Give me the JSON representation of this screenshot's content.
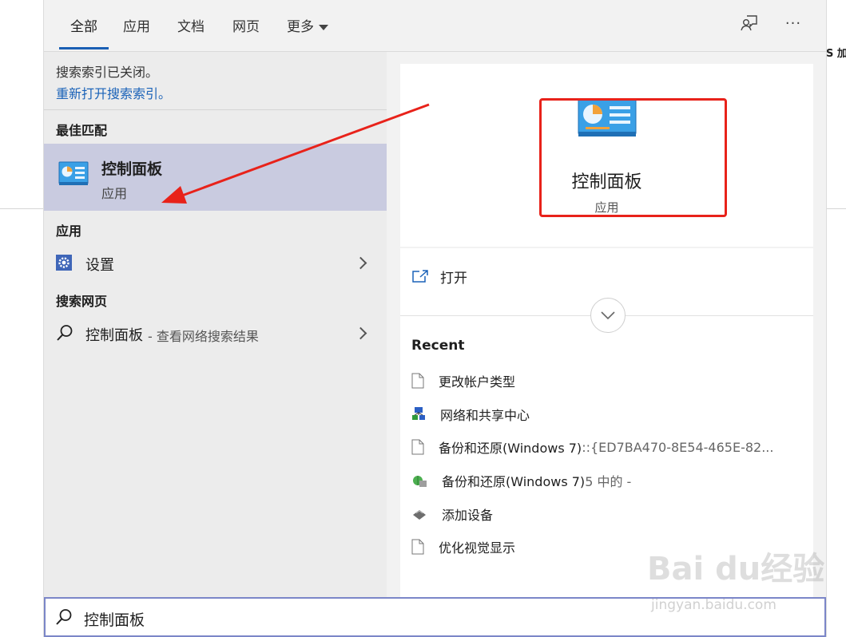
{
  "background": {
    "fragment_text": "S 加"
  },
  "tabs": [
    {
      "label": "全部",
      "active": true
    },
    {
      "label": "应用"
    },
    {
      "label": "文档"
    },
    {
      "label": "网页"
    },
    {
      "label": "更多"
    }
  ],
  "toolbar": {
    "feedback_icon": "feedback-icon",
    "more_icon": "more-icon",
    "more_label": "···"
  },
  "left": {
    "notice": "搜索索引已关闭。",
    "reopen_link": "重新打开搜索索引。",
    "best_match_header": "最佳匹配",
    "best_match": {
      "title": "控制面板",
      "subtitle": "应用",
      "icon": "control-panel-icon"
    },
    "apps_header": "应用",
    "apps": [
      {
        "label": "设置",
        "icon": "gear-icon"
      }
    ],
    "web_header": "搜索网页",
    "web": [
      {
        "label": "控制面板",
        "suffix": " - 查看网络搜索结果",
        "icon": "search-icon"
      }
    ]
  },
  "right": {
    "hero": {
      "title": "控制面板",
      "subtitle": "应用",
      "icon": "control-panel-icon"
    },
    "open_label": "打开",
    "recent_header": "Recent",
    "recent": [
      {
        "label": "更改帐户类型",
        "icon": "document-icon"
      },
      {
        "label": "网络和共享中心",
        "icon": "network-icon"
      },
      {
        "label": "备份和还原(Windows 7)",
        "suffix": "::{ED7BA470-8E54-465E-82...",
        "icon": "document-icon"
      },
      {
        "label": "备份和还原(Windows 7)",
        "suffix": "5 中的 -",
        "icon": "backup-icon"
      },
      {
        "label": "添加设备",
        "icon": "device-icon"
      },
      {
        "label": "优化视觉显示",
        "icon": "document-icon"
      }
    ]
  },
  "search": {
    "value": "控制面板",
    "icon": "search-icon"
  },
  "watermark": {
    "brand": "Bai du经验",
    "url": "jingyan.baidu.com"
  },
  "colors": {
    "accent": "#1a5fb4",
    "highlight": "#c9cbe0",
    "annotation": "#e8221a",
    "search_border": "#7b86c8"
  }
}
